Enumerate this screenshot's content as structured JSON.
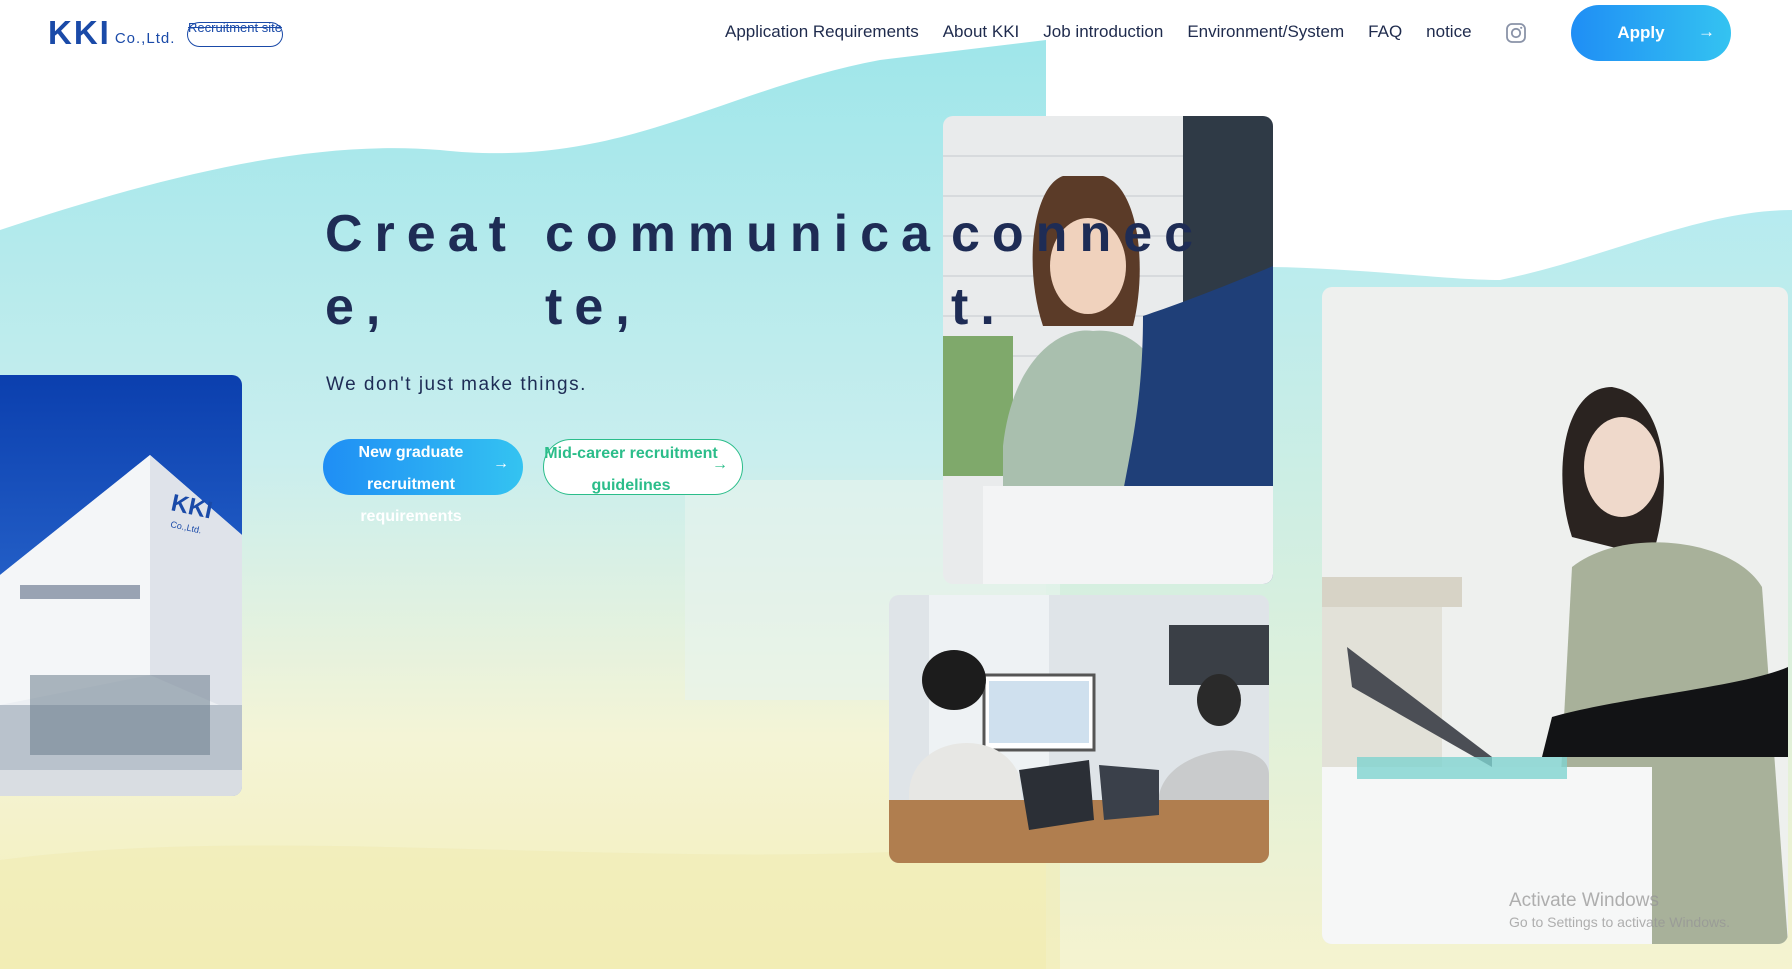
{
  "header": {
    "logo_mark": "KKI",
    "logo_sub": "Co.,Ltd.",
    "site_label": "Recruitment site",
    "nav": [
      "Application Requirements",
      "About KKI",
      "Job introduction",
      "Environment/System",
      "FAQ",
      "notice"
    ],
    "instagram_icon": "instagram-icon",
    "apply_label": "Apply"
  },
  "hero": {
    "title_words": [
      "Creat e,",
      "communica te,",
      "connec t."
    ],
    "title_lines": [
      [
        "Creat",
        "communica",
        "connec"
      ],
      [
        "e,",
        "te,",
        "t."
      ]
    ],
    "subtitle": "We don't just make things.",
    "btn_new": "New graduate recruitment requirements",
    "btn_mid": "Mid-career recruitment guidelines"
  },
  "photos": {
    "building_sign": "KKI",
    "building_sign_sub": "Co.,Ltd."
  },
  "watermark": {
    "line1": "Activate Windows",
    "line2": "Go to Settings to activate Windows."
  },
  "colors": {
    "navy": "#1e2c55",
    "brand_blue": "#1a4aa8",
    "btn_gradient_start": "#1f8ef5",
    "btn_gradient_end": "#34c3f1",
    "mid_green": "#2bbd8a"
  }
}
